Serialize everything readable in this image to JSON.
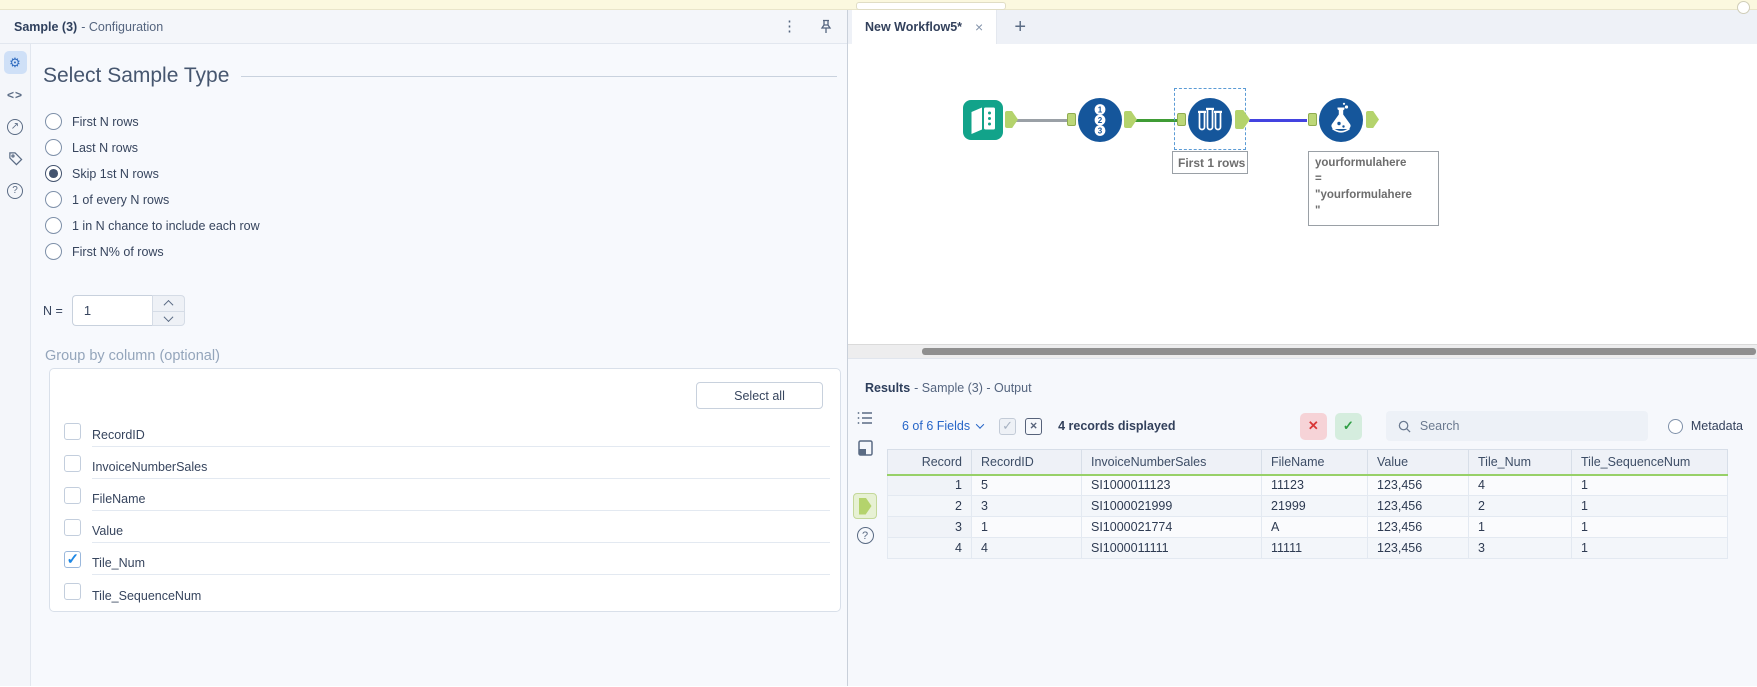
{
  "config": {
    "header": {
      "title_bold": "Sample (3)",
      "title_rest": "- Configuration",
      "kebab": "⋮"
    },
    "rail_icons": [
      "gear-icon",
      "code-icon",
      "open-in-new-icon",
      "tag-icon",
      "help-icon"
    ],
    "section_title": "Select Sample Type",
    "radios": [
      {
        "label": "First N rows",
        "selected": false
      },
      {
        "label": "Last N rows",
        "selected": false
      },
      {
        "label": "Skip 1st N rows",
        "selected": true
      },
      {
        "label": "1 of every N rows",
        "selected": false
      },
      {
        "label": "1 in N chance to include each row",
        "selected": false
      },
      {
        "label": "First N% of rows",
        "selected": false
      }
    ],
    "n_field": {
      "label": "N =",
      "value": "1"
    },
    "group_by": {
      "label": "Group by column (optional)",
      "select_all_label": "Select all",
      "items": [
        {
          "label": "RecordID",
          "checked": false
        },
        {
          "label": "InvoiceNumberSales",
          "checked": false
        },
        {
          "label": "FileName",
          "checked": false
        },
        {
          "label": "Value",
          "checked": false
        },
        {
          "label": "Tile_Num",
          "checked": true
        },
        {
          "label": "Tile_SequenceNum",
          "checked": false
        }
      ]
    }
  },
  "workflow": {
    "tab": {
      "label": "New Workflow5*",
      "close": "×",
      "new_tab": "+"
    },
    "nodes": [
      {
        "name": "input-data-tool"
      },
      {
        "name": "record-id-tool"
      },
      {
        "name": "sample-tool",
        "selected": true,
        "annotation": "First 1 rows"
      },
      {
        "name": "formula-tool"
      }
    ],
    "sample_annotation": "First 1 rows",
    "formula_annotation": {
      "line1": "yourformulahere",
      "line2": "=",
      "line3": "\"yourformulahere",
      "line4": "\""
    }
  },
  "results": {
    "header": {
      "title_bold": "Results",
      "title_rest": "- Sample (3) - Output"
    },
    "toolbar": {
      "fields_label": "6 of 6 Fields",
      "records_label": "4 records displayed",
      "reject_label": "✕",
      "accept_label": "✓",
      "search_placeholder": "Search",
      "metadata_label": "Metadata"
    },
    "table": {
      "columns": [
        "Record",
        "RecordID",
        "InvoiceNumberSales",
        "FileName",
        "Value",
        "Tile_Num",
        "Tile_SequenceNum"
      ],
      "rows": [
        [
          "1",
          "5",
          "SI1000011123",
          "11123",
          "123,456",
          "4",
          "1"
        ],
        [
          "2",
          "3",
          "SI1000021999",
          "21999",
          "123,456",
          "2",
          "1"
        ],
        [
          "3",
          "1",
          "SI1000021774",
          "A",
          "123,456",
          "1",
          "1"
        ],
        [
          "4",
          "4",
          "SI1000011111",
          "11111",
          "123,456",
          "3",
          "1"
        ]
      ]
    }
  },
  "colors": {
    "node_blue": "#15569b",
    "node_teal": "#12a38a",
    "anchor_green": "#b4d36c",
    "wire_green": "#3f9c35",
    "wire_blue": "#4343e0",
    "accent_blue": "#2766c8",
    "header_underline_green": "#97d068"
  }
}
